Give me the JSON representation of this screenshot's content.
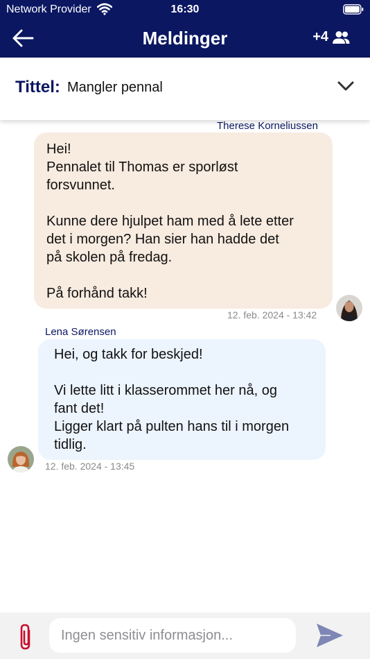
{
  "status_bar": {
    "carrier": "Network Provider",
    "time": "16:30"
  },
  "nav": {
    "title": "Meldinger",
    "participants_count": "+4"
  },
  "subject": {
    "label": "Tittel:",
    "value": "Mangler pennal"
  },
  "messages": [
    {
      "sender": "Therese Korneliussen",
      "lines": [
        "Hei!",
        "Pennalet til Thomas er sporløst",
        "forsvunnet.",
        "",
        "Kunne dere hjulpet ham med å lete etter",
        "det i morgen? Han sier han hadde det",
        "på skolen på fredag.",
        "",
        "På forhånd takk!"
      ],
      "timestamp": "12. feb. 2024 - 13:42",
      "direction": "outgoing"
    },
    {
      "sender": "Lena Sørensen",
      "lines": [
        "Hei, og takk for beskjed!",
        "",
        "Vi lette litt i klasserommet her nå, og",
        "fant det!",
        "Ligger klart på pulten hans til i morgen",
        "tidlig."
      ],
      "timestamp": "12. feb. 2024 - 13:45",
      "direction": "incoming"
    }
  ],
  "composer": {
    "placeholder": "Ingen sensitiv informasjon..."
  },
  "colors": {
    "primary": "#0b1761",
    "outgoing_bubble": "#f8ebe0",
    "incoming_bubble": "#ecf4fe",
    "attach_icon": "#c8102e",
    "send_icon": "#7d86b5"
  },
  "icons": {
    "back": "arrow-left-icon",
    "participants": "people-icon",
    "expand": "chevron-down-icon",
    "attach": "paperclip-icon",
    "send": "send-icon"
  }
}
